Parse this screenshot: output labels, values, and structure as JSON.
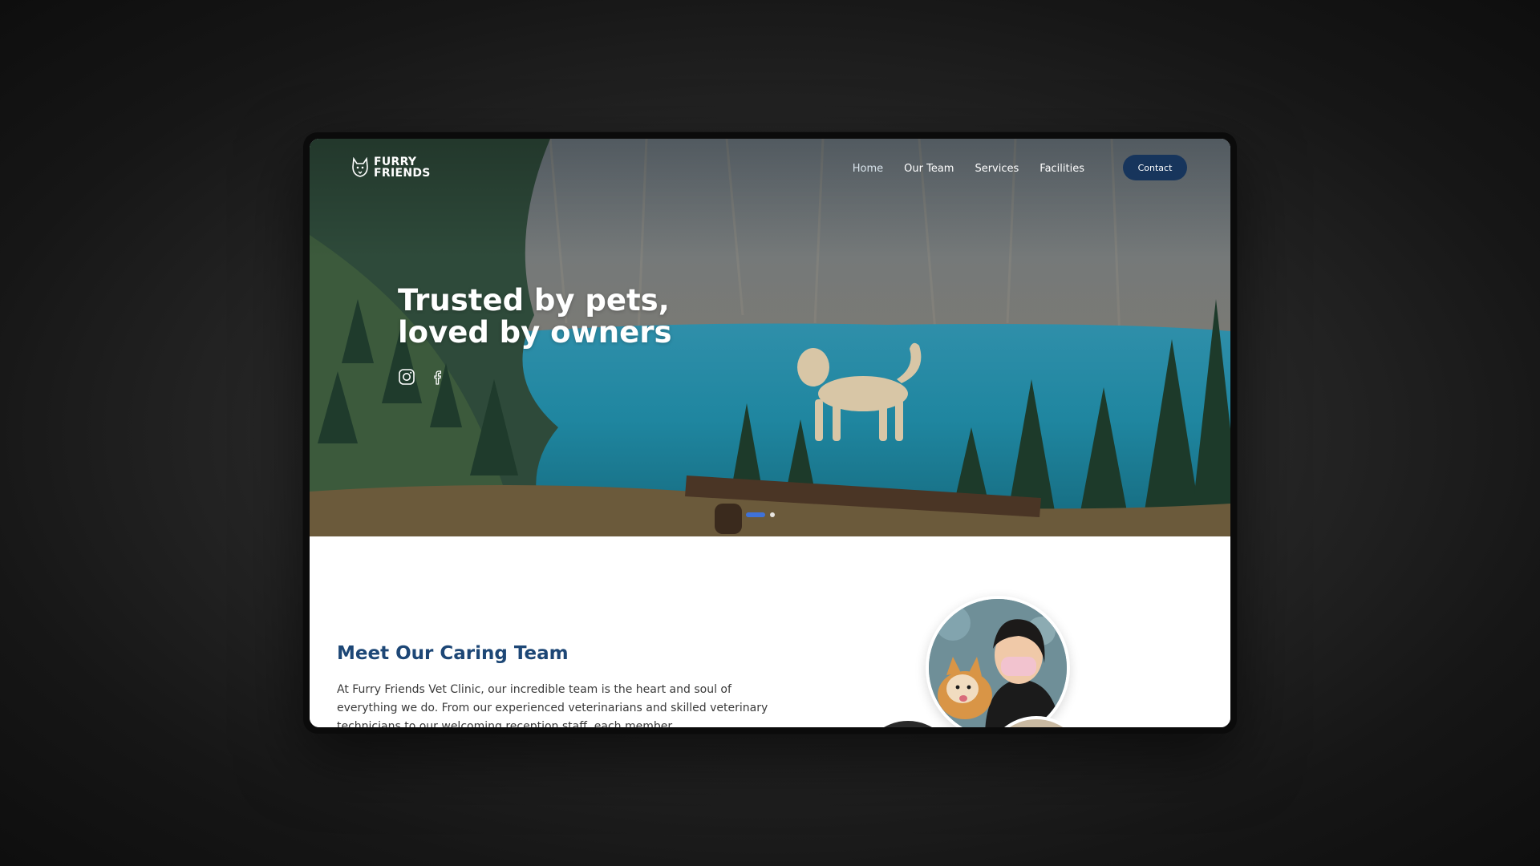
{
  "brand": {
    "line1": "FURRY",
    "line2": "FRIENDS",
    "logo_icon": "husky-head-icon"
  },
  "nav": {
    "items": [
      {
        "label": "Home",
        "active": true
      },
      {
        "label": "Our Team",
        "active": false
      },
      {
        "label": "Services",
        "active": false
      },
      {
        "label": "Facilities",
        "active": false
      }
    ],
    "contact_label": "Contact"
  },
  "hero": {
    "title_line1": "Trusted by pets,",
    "title_line2": "loved by owners",
    "social_icons": [
      "instagram-icon",
      "facebook-icon"
    ],
    "slider": {
      "count": 2,
      "active_index": 0
    }
  },
  "team": {
    "title": "Meet Our Caring Team",
    "text": "At Furry Friends Vet Clinic, our incredible team is the heart and soul of everything we do. From our experienced veterinarians and skilled veterinary technicians to our welcoming reception staff, each member"
  },
  "colors": {
    "primary_navy": "#17355c",
    "heading_blue": "#1d4776",
    "slider_active": "#3f72d8"
  }
}
